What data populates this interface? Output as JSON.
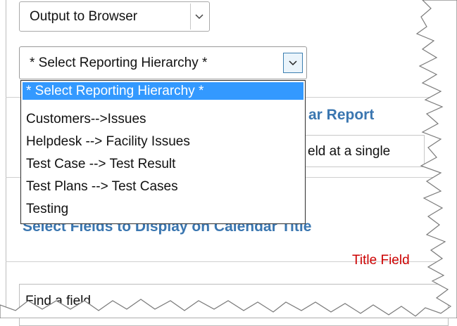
{
  "output_select": {
    "value": "Output to Browser"
  },
  "hierarchy_select": {
    "value": "* Select Reporting Hierarchy *",
    "options": [
      "* Select Reporting Hierarchy *",
      "Customers-->Issues",
      "Helpdesk --> Facility Issues",
      "Test Case --> Test Result",
      "Test Plans --> Test Cases",
      "Testing"
    ],
    "selected_index": 0
  },
  "background": {
    "report_title_fragment": "ar Report",
    "field_text_fragment": "eld at a single",
    "fields_section_title": "Select Fields to Display on Calendar Title",
    "title_field_label": "Title Field",
    "find_field_text": "Find a field"
  },
  "colors": {
    "highlight": "#3399ff",
    "section_title": "#3a76b0",
    "title_label": "#cc0000"
  }
}
